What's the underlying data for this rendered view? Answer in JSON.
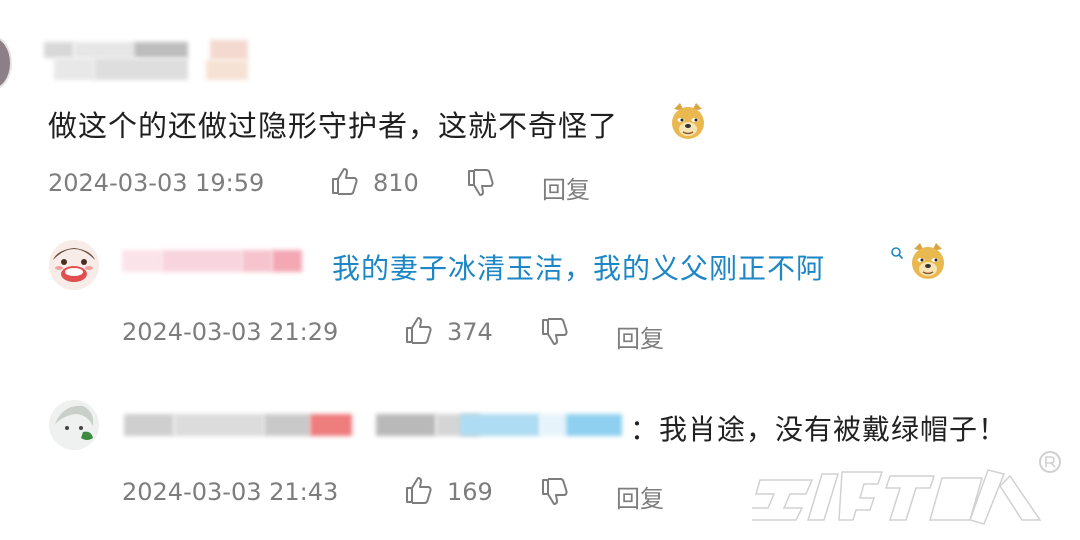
{
  "comments": [
    {
      "text": "做这个的还做过隐形守护者，这就不奇怪了",
      "timestamp": "2024-03-03 19:59",
      "likes": "810",
      "reply_label": "回复",
      "emoji": "doge-emoji"
    },
    {
      "text": "我的妻子冰清玉洁，我的义父刚正不阿",
      "timestamp": "2024-03-03 21:29",
      "likes": "374",
      "reply_label": "回复",
      "emoji": "doge-emoji"
    },
    {
      "text": "：我肖途，没有被戴绿帽子！",
      "timestamp": "2024-03-03 21:43",
      "likes": "169",
      "reply_label": "回复"
    }
  ],
  "icons": {
    "like": "thumbs-up-icon",
    "dislike": "thumbs-down-icon",
    "search": "search-icon"
  },
  "colors": {
    "link_blue": "#1d86c6",
    "meta_gray": "#7d7d7d"
  }
}
